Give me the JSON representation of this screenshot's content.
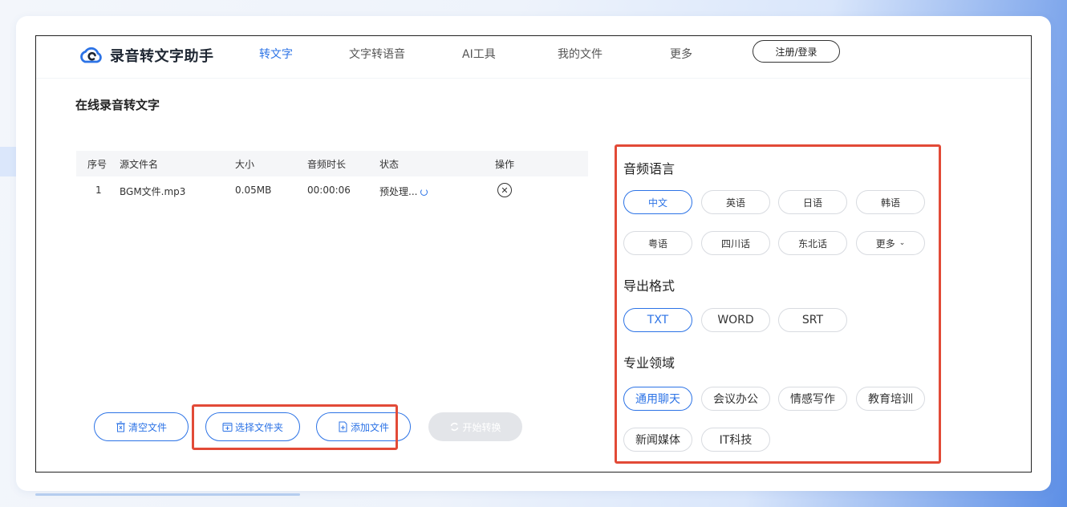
{
  "app": {
    "name": "录音转文字助手"
  },
  "nav": {
    "items": [
      "转文字",
      "文字转语音",
      "AI工具",
      "我的文件",
      "更多"
    ],
    "active_index": 0,
    "login_label": "注册/登录"
  },
  "page": {
    "title": "在线录音转文字"
  },
  "table": {
    "headers": [
      "序号",
      "源文件名",
      "大小",
      "音频时长",
      "状态",
      "操作"
    ],
    "rows": [
      {
        "index": "1",
        "name": "BGM文件.mp3",
        "size": "0.05MB",
        "duration": "00:00:06",
        "status": "预处理..."
      }
    ]
  },
  "actions": {
    "clear": "清空文件",
    "select_folder": "选择文件夹",
    "add_file": "添加文件",
    "start": "开始转换"
  },
  "options": {
    "language": {
      "title": "音频语言",
      "items": [
        "中文",
        "英语",
        "日语",
        "韩语",
        "粤语",
        "四川话",
        "东北话",
        "更多"
      ],
      "selected": "中文"
    },
    "format": {
      "title": "导出格式",
      "items": [
        "TXT",
        "WORD",
        "SRT"
      ],
      "selected": "TXT"
    },
    "domain": {
      "title": "专业领域",
      "items": [
        "通用聊天",
        "会议办公",
        "情感写作",
        "教育培训",
        "新闻媒体",
        "IT科技"
      ],
      "selected": "通用聊天"
    }
  },
  "colors": {
    "accent": "#2c73e6",
    "highlight_box": "#e24a37"
  }
}
